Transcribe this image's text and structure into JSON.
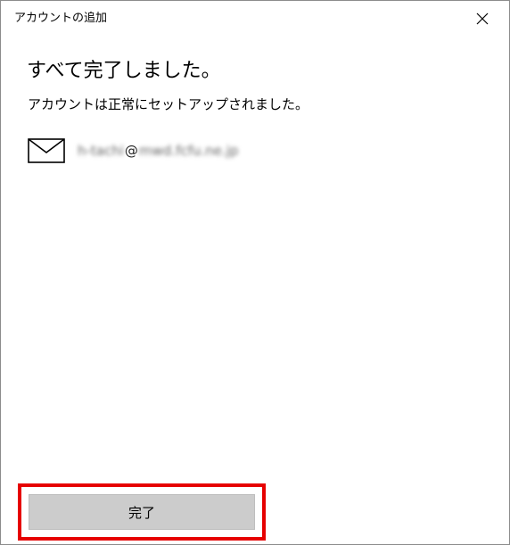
{
  "window": {
    "title": "アカウントの追加",
    "close_icon": "close-icon"
  },
  "content": {
    "heading": "すべて完了しました。",
    "subheading": "アカウントは正常にセットアップされました。",
    "account": {
      "icon": "mail-icon",
      "email_local": "h-tachi",
      "email_at": "@",
      "email_domain": "mwd.fcfu.ne.jp"
    }
  },
  "footer": {
    "done_label": "完了"
  },
  "colors": {
    "highlight": "#e60000",
    "button_bg": "#cccccc",
    "window_border": "#8c8c8c"
  }
}
